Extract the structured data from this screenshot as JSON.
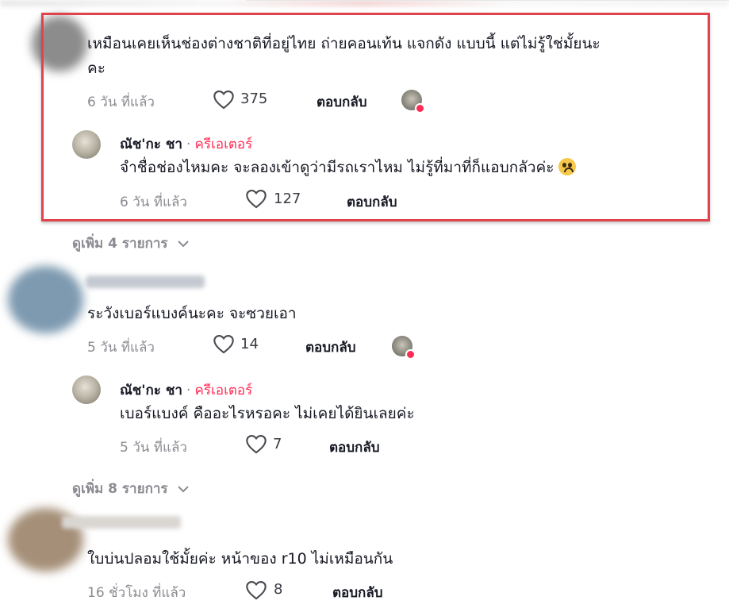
{
  "comments": [
    {
      "text": "เหมือนเคยเห็นช่องต่างชาติที่อยู่ไทย ถ่ายคอนเท้น แจกดัง แบบนี้ แต่ไม่รู้ใช่มั้ยนะ",
      "text_line2": "คะ",
      "time": "6 วัน ที่แล้ว",
      "likes": "375",
      "reply": "ตอบกลับ",
      "reply_item": {
        "name": "ณัช'กะ ชา",
        "separator": "·",
        "role": "ครีเอเตอร์",
        "text": "จำชื่อช่องไหมคะ จะลองเข้าดูว่ามีรถเราไหม ไม่รู้ที่มาที่ก็แอบกลัวค่ะ",
        "time": "6 วัน ที่แล้ว",
        "likes": "127",
        "reply": "ตอบกลับ"
      },
      "more": "ดูเพิ่ม 4 รายการ"
    },
    {
      "text": "ระวังเบอร์แบงค์นะคะ จะซวยเอา",
      "time": "5 วัน ที่แล้ว",
      "likes": "14",
      "reply": "ตอบกลับ",
      "reply_item": {
        "name": "ณัช'กะ ชา",
        "separator": "·",
        "role": "ครีเอเตอร์",
        "text": "เบอร์แบงค์ คืออะไรหรอคะ ไม่เคยได้ยินเลยค่ะ",
        "time": "5 วัน ที่แล้ว",
        "likes": "7",
        "reply": "ตอบกลับ"
      },
      "more": "ดูเพิ่ม 8 รายการ"
    },
    {
      "text": "ใบบ่นปลอมใช้มั้ยค่ะ หน้าของ r10 ไม่เหมือนกัน",
      "time": "16 ชั่วโมง ที่แล้ว",
      "likes": "8",
      "reply": "ตอบกลับ"
    }
  ],
  "colors": {
    "highlight": "#e0434b",
    "creator": "#fe2c55",
    "muted": "#8a8b91"
  },
  "icons": [
    "heart-icon",
    "chevron-down-icon",
    "creator-liked-avatar-icon",
    "sad-face-emoji-icon"
  ]
}
